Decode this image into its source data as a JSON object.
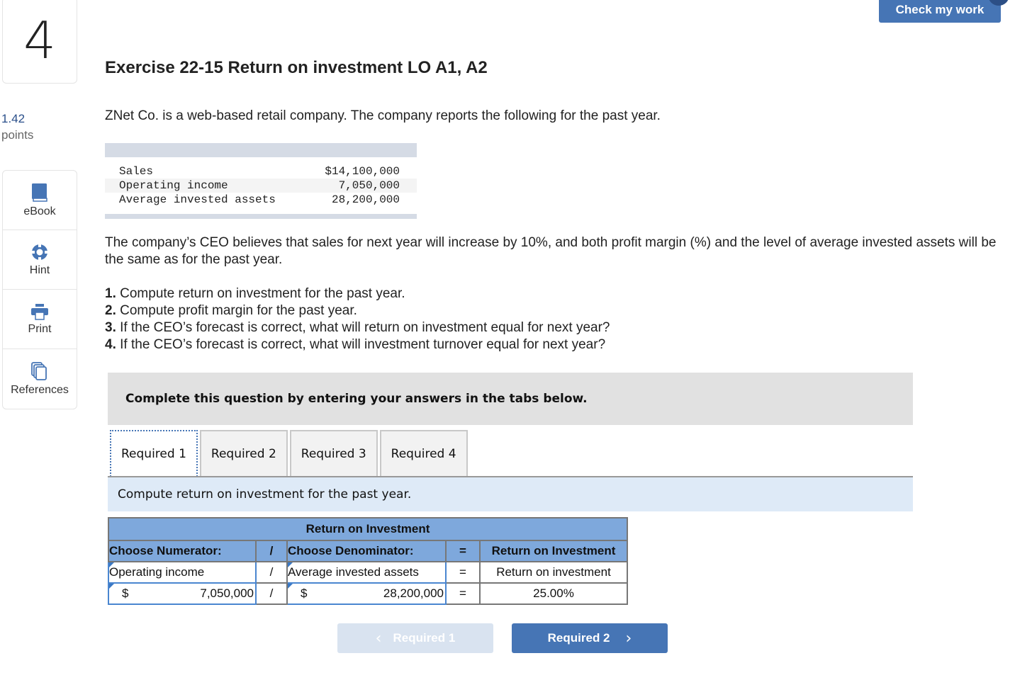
{
  "question": {
    "number": "4",
    "points_value": "1.42",
    "points_label": "points",
    "title": "Exercise 22-15 Return on investment LO A1, A2",
    "intro": "ZNet Co. is a web-based retail company. The company reports the following for the past year.",
    "data_rows": [
      {
        "label": "Sales",
        "value": "$14,100,000"
      },
      {
        "label": "Operating income",
        "value": "7,050,000"
      },
      {
        "label": "Average invested assets",
        "value": "28,200,000"
      }
    ],
    "paragraph": "The company’s CEO believes that sales for next year will increase by 10%, and both profit margin (%) and the level of average invested assets will be the same as for the past year.",
    "requirements": [
      {
        "num": "1.",
        "text": " Compute return on investment for the past year."
      },
      {
        "num": "2.",
        "text": " Compute profit margin for the past year."
      },
      {
        "num": "3.",
        "text": " If the CEO’s forecast is correct, what will return on investment equal for next year?"
      },
      {
        "num": "4.",
        "text": " If the CEO’s forecast is correct, what will investment turnover equal for next year?"
      }
    ]
  },
  "sidebar": {
    "tools": [
      {
        "label": "eBook",
        "icon": "book-icon"
      },
      {
        "label": "Hint",
        "icon": "lifebuoy-icon"
      },
      {
        "label": "Print",
        "icon": "printer-icon"
      },
      {
        "label": "References",
        "icon": "copy-documents-icon"
      }
    ]
  },
  "header": {
    "check_label": "Check my work"
  },
  "instructions": "Complete this question by entering your answers in the tabs below.",
  "tabs": [
    {
      "label": "Required 1",
      "active": true
    },
    {
      "label": "Required 2",
      "active": false
    },
    {
      "label": "Required 3",
      "active": false
    },
    {
      "label": "Required 4",
      "active": false
    }
  ],
  "task_text": "Compute return on investment for the past year.",
  "roi_table": {
    "title": "Return on Investment",
    "headers": {
      "numerator": "Choose Numerator:",
      "divide": "/",
      "denominator": "Choose Denominator:",
      "equals": "=",
      "result": "Return on Investment"
    },
    "row1": {
      "numerator": "Operating income",
      "divide": "/",
      "denominator": "Average invested assets",
      "equals": "=",
      "result": "Return on investment"
    },
    "row2": {
      "num_currency": "$",
      "numerator_value": "7,050,000",
      "divide": "/",
      "den_currency": "$",
      "denominator_value": "28,200,000",
      "equals": "=",
      "result_value": "25.00%"
    }
  },
  "navigation": {
    "prev_label": "Required 1",
    "next_label": "Required 2",
    "prev_chevron": "‹",
    "next_chevron": "›"
  },
  "colors": {
    "accent": "#4675b5",
    "table_header": "#7ea8dc",
    "task_bg": "#deeaf7"
  }
}
